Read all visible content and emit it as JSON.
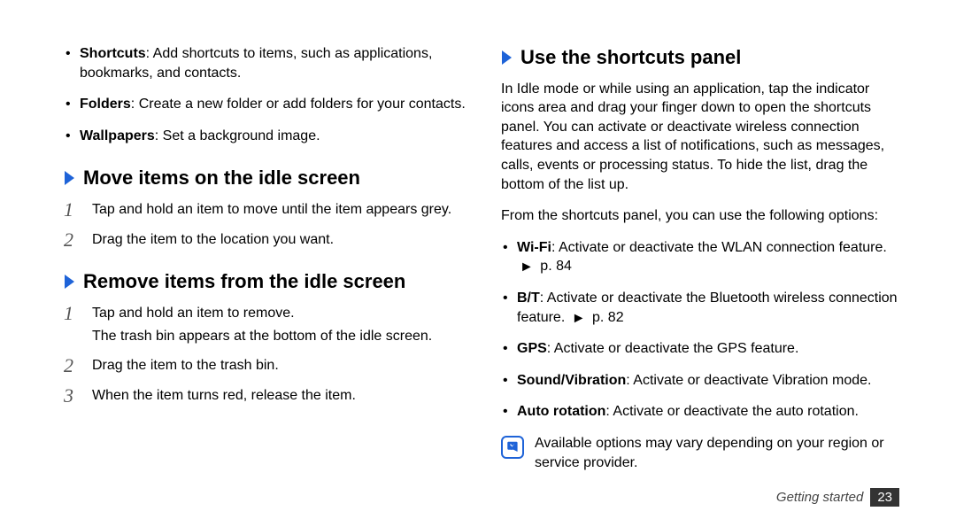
{
  "left": {
    "bullets": [
      {
        "term": "Shortcuts",
        "text": ": Add shortcuts to items, such as applications, bookmarks, and contacts."
      },
      {
        "term": "Folders",
        "text": ": Create a new folder or add folders for your contacts."
      },
      {
        "term": "Wallpapers",
        "text": ": Set a background image."
      }
    ],
    "move": {
      "heading": "Move items on the idle screen",
      "step1": "Tap and hold an item to move until the item appears grey.",
      "step2": "Drag the item to the location you want."
    },
    "remove": {
      "heading": "Remove items from the idle screen",
      "step1a": "Tap and hold an item to remove.",
      "step1b": "The trash bin appears at the bottom of the idle screen.",
      "step2": "Drag the item to the trash bin.",
      "step3": "When the item turns red, release the item."
    }
  },
  "right": {
    "heading": "Use the shortcuts panel",
    "intro": "In Idle mode or while using an application, tap the indicator icons area and drag your finger down to open the shortcuts panel. You can activate or deactivate wireless connection features and access a list of notifications, such as messages, calls, events or processing status. To hide the list, drag the bottom of the list up.",
    "lead": "From the shortcuts panel, you can use the following options:",
    "opts": [
      {
        "term": "Wi-Fi",
        "text": ": Activate or deactivate the WLAN connection feature. ",
        "ref": "p. 84"
      },
      {
        "term": "B/T",
        "text": ": Activate or deactivate the Bluetooth wireless connection feature. ",
        "ref": "p. 82"
      },
      {
        "term": "GPS",
        "text": ": Activate or deactivate the GPS feature."
      },
      {
        "term": "Sound/Vibration",
        "text": ": Activate or deactivate Vibration mode."
      },
      {
        "term": "Auto rotation",
        "text": ": Activate or deactivate the auto rotation."
      }
    ],
    "note": "Available options may vary depending on your region or service provider."
  },
  "footer": {
    "section": "Getting started",
    "page": "23"
  },
  "nums": {
    "n1": "1",
    "n2": "2",
    "n3": "3"
  }
}
